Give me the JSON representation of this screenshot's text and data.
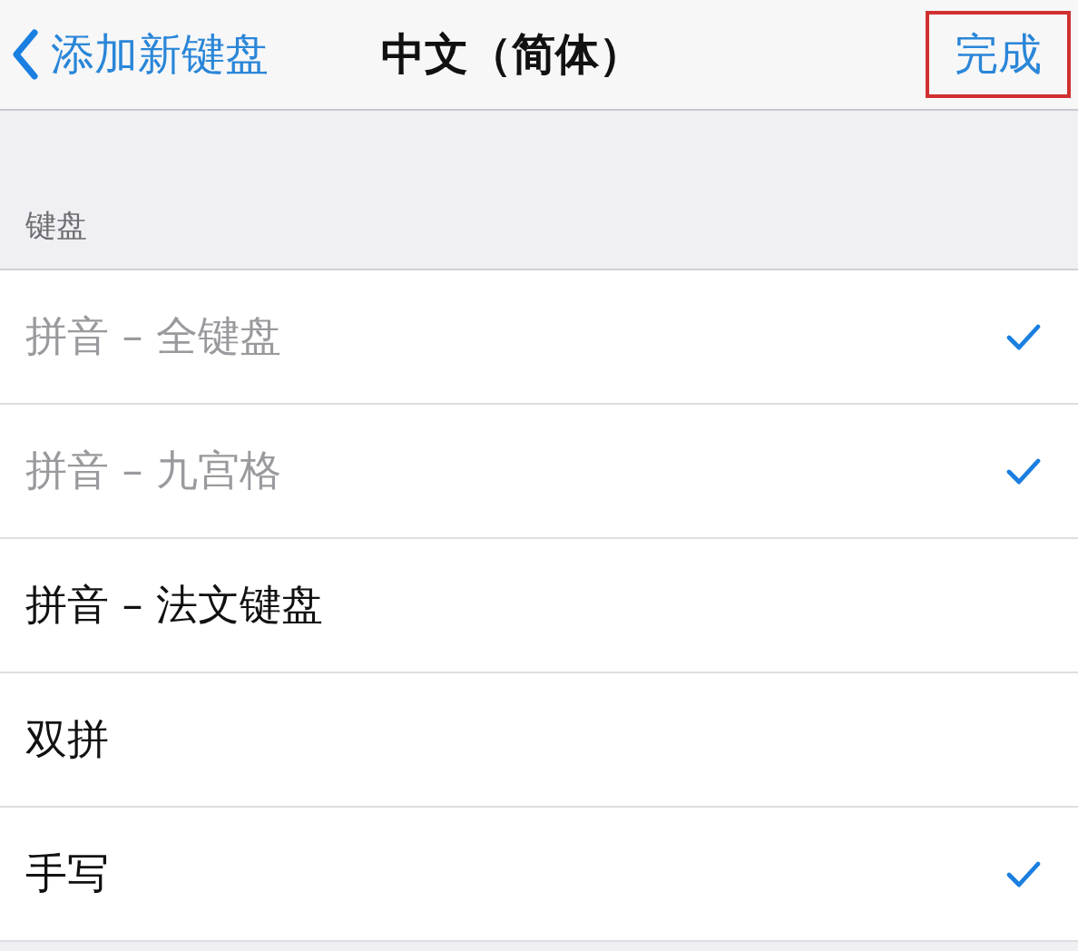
{
  "nav_bar": {
    "back_label": "添加新键盘",
    "title": "中文（简体）",
    "done_button": {
      "label": "完成",
      "highlighted": true
    }
  },
  "section": {
    "header": "键盘",
    "rows": [
      {
        "label": "拼音 – 全键盘",
        "disabled": true,
        "checked": true
      },
      {
        "label": "拼音 – 九宫格",
        "disabled": true,
        "checked": true
      },
      {
        "label": "拼音 – 法文键盘",
        "disabled": false,
        "checked": false
      },
      {
        "label": "双拼",
        "disabled": false,
        "checked": false
      },
      {
        "label": "手写",
        "disabled": false,
        "checked": true
      }
    ]
  }
}
